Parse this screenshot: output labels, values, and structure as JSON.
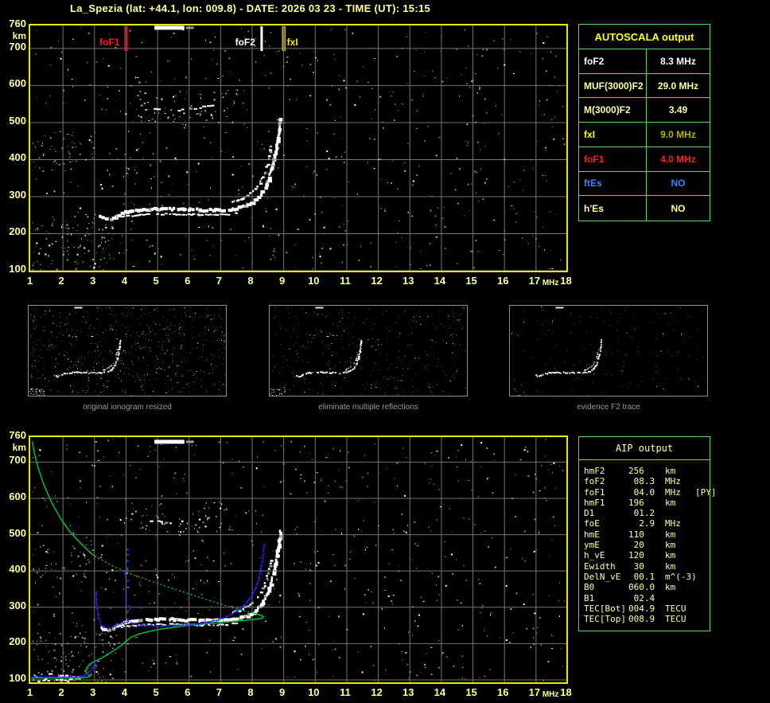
{
  "header": {
    "title": "La_Spezia (lat: +44.1, lon: 009.8) - DATE: 2026 03 23 - TIME (UT): 15:15"
  },
  "autoscala": {
    "title": "AUTOSCALA output",
    "rows": [
      {
        "label": "foF2",
        "value": "8.3 MHz",
        "label_color": "#ffffff",
        "value_color": "#ffffff"
      },
      {
        "label": "MUF(3000)F2",
        "value": "29.0 MHz",
        "label_color": "#ffff9c",
        "value_color": "#ffff9c"
      },
      {
        "label": "M(3000)F2",
        "value": "3.49",
        "label_color": "#ffff9c",
        "value_color": "#ffff9c"
      },
      {
        "label": "fxI",
        "value": "9.0 MHz",
        "label_color": "#ffff00",
        "value_color": "#b4b400"
      },
      {
        "label": "foF1",
        "value": "4.0 MHz",
        "label_color": "#ff1e1e",
        "value_color": "#ff1e1e"
      },
      {
        "label": "ftEs",
        "value": "NO",
        "label_color": "#3b82ff",
        "value_color": "#3b82ff"
      },
      {
        "label": "h'Es",
        "value": "NO",
        "label_color": "#ffff9c",
        "value_color": "#ffff9c"
      }
    ]
  },
  "aip": {
    "title": "AIP output",
    "rows": [
      {
        "label": "hmF2",
        "value": "256",
        "unit": "km",
        "extra": ""
      },
      {
        "label": "foF2",
        "value": " 08.3",
        "unit": "MHz",
        "extra": ""
      },
      {
        "label": "foF1",
        "value": " 04.0",
        "unit": "MHz",
        "extra": "[PY]"
      },
      {
        "label": "hmF1",
        "value": "196",
        "unit": "km",
        "extra": ""
      },
      {
        "label": "D1",
        "value": " 01.2",
        "unit": "",
        "extra": ""
      },
      {
        "label": "foE",
        "value": "  2.9",
        "unit": "MHz",
        "extra": ""
      },
      {
        "label": "hmE",
        "value": "110",
        "unit": "km",
        "extra": ""
      },
      {
        "label": "ymE",
        "value": " 20",
        "unit": "km",
        "extra": ""
      },
      {
        "label": "h_vE",
        "value": "120",
        "unit": "km",
        "extra": ""
      },
      {
        "label": "Ewidth",
        "value": " 30",
        "unit": "km",
        "extra": ""
      },
      {
        "label": "DelN_vE",
        "value": " 00.1",
        "unit": "m^(-3)",
        "extra": ""
      },
      {
        "label": "B0",
        "value": "060.0",
        "unit": "km",
        "extra": ""
      },
      {
        "label": "B1",
        "value": " 02.4",
        "unit": "",
        "extra": ""
      },
      {
        "label": "TEC[Bot]",
        "value": "004.9",
        "unit": "TECU",
        "extra": ""
      },
      {
        "label": "TEC[Top]",
        "value": "008.9",
        "unit": "TECU",
        "extra": ""
      }
    ]
  },
  "thumbnails": [
    {
      "caption": "original ionogram resized"
    },
    {
      "caption": "eliminate multiple reflections"
    },
    {
      "caption": "evidence F2 trace"
    }
  ],
  "colors": {
    "axis_label": "#ffff9c",
    "plot_border": "#e8e800",
    "grid": "#757575",
    "table_border": "#5fd35f",
    "profile_green": "#00c83c",
    "restored_blue": "#2626ff",
    "echo_white": "#ffffff"
  },
  "chart_data": [
    {
      "type": "scatter",
      "panel": "top-ionogram",
      "xlabel": "MHz",
      "ylabel": "km",
      "xlim": [
        1,
        18
      ],
      "ylim": [
        100,
        760
      ],
      "grid": true,
      "x_ticks": [
        "1",
        "2",
        "3",
        "4",
        "5",
        "6",
        "7",
        "8",
        "9",
        "10",
        "11",
        "12",
        "13",
        "14",
        "15",
        "16",
        "17",
        "18"
      ],
      "y_ticks": [
        "760",
        "700",
        "600",
        "500",
        "400",
        "300",
        "200",
        "100"
      ],
      "markers": [
        {
          "label": "foF1",
          "f": 4.0,
          "color": "#ff1e1e",
          "style": "double",
          "side": "left"
        },
        {
          "label": "foF2",
          "f": 8.3,
          "color": "#ffffff",
          "style": "single",
          "side": "left"
        },
        {
          "label": "fxI",
          "f": 9.0,
          "color": "#ffe400",
          "style": "double",
          "side": "right"
        }
      ],
      "series": [
        {
          "name": "F-trace O-mode (virtual height, km vs MHz)",
          "points": [
            [
              3.15,
              247
            ],
            [
              3.25,
              240
            ],
            [
              3.4,
              237
            ],
            [
              3.55,
              241
            ],
            [
              3.75,
              251
            ],
            [
              3.95,
              258
            ],
            [
              4.2,
              262
            ],
            [
              4.6,
              265
            ],
            [
              5.0,
              266
            ],
            [
              5.4,
              266
            ],
            [
              5.8,
              265
            ],
            [
              6.2,
              264
            ],
            [
              6.6,
              263
            ],
            [
              7.0,
              263
            ],
            [
              7.3,
              265
            ],
            [
              7.55,
              269
            ],
            [
              7.8,
              275
            ],
            [
              8.0,
              284
            ],
            [
              8.17,
              297
            ],
            [
              8.32,
              315
            ],
            [
              8.45,
              339
            ],
            [
              8.56,
              367
            ],
            [
              8.65,
              397
            ],
            [
              8.72,
              428
            ],
            [
              8.78,
              459
            ],
            [
              8.83,
              489
            ],
            [
              8.86,
              508
            ]
          ]
        },
        {
          "name": "F-trace inner edge",
          "points": [
            [
              3.85,
              246
            ],
            [
              4.3,
              250
            ],
            [
              4.8,
              252
            ],
            [
              5.3,
              253
            ],
            [
              5.8,
              252
            ],
            [
              6.3,
              251
            ],
            [
              6.8,
              251
            ],
            [
              7.2,
              252
            ],
            [
              7.5,
              257
            ]
          ]
        },
        {
          "name": "X-mode rise",
          "points": [
            [
              7.35,
              285
            ],
            [
              7.6,
              293
            ],
            [
              7.85,
              304
            ],
            [
              8.05,
              318
            ],
            [
              8.22,
              336
            ],
            [
              8.35,
              360
            ],
            [
              8.45,
              388
            ],
            [
              8.52,
              414
            ],
            [
              8.56,
              434
            ]
          ]
        },
        {
          "name": "second-hop echo",
          "points": [
            [
              4.45,
              545
            ],
            [
              4.75,
              538
            ],
            [
              5.1,
              534
            ],
            [
              5.5,
              533
            ],
            [
              5.9,
              536
            ],
            [
              6.3,
              540
            ],
            [
              6.7,
              546
            ]
          ]
        },
        {
          "name": "spread echo at top",
          "points": [
            [
              4.9,
              757
            ],
            [
              5.85,
              757
            ],
            [
              6.15,
              757
            ]
          ]
        }
      ]
    },
    {
      "type": "scatter",
      "panel": "bottom-ionogram",
      "xlabel": "MHz",
      "ylabel": "km",
      "xlim": [
        1,
        18
      ],
      "ylim": [
        100,
        760
      ],
      "grid": true,
      "x_ticks": [
        "1",
        "2",
        "3",
        "4",
        "5",
        "6",
        "7",
        "8",
        "9",
        "10",
        "11",
        "12",
        "13",
        "14",
        "15",
        "16",
        "17",
        "18"
      ],
      "y_ticks": [
        "760",
        "700",
        "600",
        "500",
        "400",
        "300",
        "200",
        "100"
      ],
      "echo_traces_ref": "same white echo series as top-ionogram",
      "series": [
        {
          "name": "electron density profile topside (green solid)",
          "points": [
            [
              1.02,
              757
            ],
            [
              1.1,
              722
            ],
            [
              1.22,
              682
            ],
            [
              1.4,
              636
            ],
            [
              1.62,
              592
            ],
            [
              1.9,
              548
            ],
            [
              2.2,
              510
            ],
            [
              2.55,
              477
            ],
            [
              2.85,
              452
            ],
            [
              3.0,
              441
            ]
          ]
        },
        {
          "name": "electron density profile topside (green dotted)",
          "points": [
            [
              3.0,
              441
            ],
            [
              3.6,
              413
            ],
            [
              4.2,
              390
            ],
            [
              4.8,
              372
            ],
            [
              5.4,
              354
            ],
            [
              6.0,
              337
            ],
            [
              6.6,
              320
            ],
            [
              7.2,
              303
            ],
            [
              7.7,
              291
            ],
            [
              8.0,
              285
            ]
          ]
        },
        {
          "name": "electron density profile bottomside (green solid)",
          "points": [
            [
              8.0,
              285
            ],
            [
              8.25,
              279
            ],
            [
              8.36,
              274
            ],
            [
              8.28,
              269
            ],
            [
              8.0,
              266
            ],
            [
              7.6,
              263
            ],
            [
              7.1,
              259
            ],
            [
              6.6,
              255
            ],
            [
              6.1,
              251
            ],
            [
              5.6,
              246
            ],
            [
              5.1,
              240
            ],
            [
              4.7,
              233
            ],
            [
              4.4,
              226
            ],
            [
              4.15,
              217
            ],
            [
              4.02,
              208
            ],
            [
              3.9,
              198
            ],
            [
              3.7,
              186
            ],
            [
              3.45,
              172
            ],
            [
              3.2,
              159
            ],
            [
              3.0,
              151
            ],
            [
              2.85,
              144
            ],
            [
              2.75,
              133
            ],
            [
              2.72,
              122
            ],
            [
              2.79,
              115
            ],
            [
              2.87,
              111
            ],
            [
              2.76,
              107
            ],
            [
              2.5,
              105
            ],
            [
              2.0,
              105
            ],
            [
              1.5,
              105
            ],
            [
              1.0,
              105
            ]
          ]
        },
        {
          "name": "restored trace (blue dots)",
          "points": [
            [
              3.02,
              345
            ],
            [
              3.05,
              310
            ],
            [
              3.08,
              285
            ],
            [
              3.12,
              268
            ],
            [
              3.18,
              255
            ],
            [
              3.28,
              247
            ],
            [
              3.4,
              244
            ],
            [
              3.55,
              248
            ],
            [
              3.75,
              254
            ],
            [
              3.95,
              261
            ],
            [
              4.05,
              262
            ],
            [
              4.2,
              258
            ],
            [
              4.45,
              253
            ],
            [
              4.8,
              251
            ],
            [
              5.2,
              251
            ],
            [
              5.6,
              252
            ],
            [
              6.0,
              254
            ],
            [
              6.3,
              257
            ],
            [
              6.6,
              262
            ],
            [
              6.9,
              268
            ],
            [
              7.2,
              278
            ],
            [
              7.5,
              292
            ],
            [
              7.75,
              310
            ],
            [
              7.95,
              332
            ],
            [
              8.1,
              358
            ],
            [
              8.2,
              388
            ],
            [
              8.28,
              420
            ],
            [
              8.33,
              450
            ],
            [
              8.36,
              475
            ]
          ]
        },
        {
          "name": "blue F1 cusp spike",
          "points": [
            [
              4.02,
              270
            ],
            [
              3.99,
              288
            ],
            [
              4.03,
              305
            ],
            [
              4.0,
              322
            ],
            [
              3.98,
              340
            ],
            [
              4.02,
              358
            ],
            [
              4.0,
              376
            ],
            [
              3.97,
              395
            ],
            [
              4.01,
              412
            ],
            [
              3.99,
              430
            ],
            [
              4.02,
              448
            ],
            [
              4.0,
              462
            ]
          ]
        },
        {
          "name": "blue E-region trace",
          "points": [
            [
              1.0,
              110
            ],
            [
              2.55,
              110
            ],
            [
              2.6,
              112
            ],
            [
              2.7,
              117
            ],
            [
              2.8,
              124
            ],
            [
              2.9,
              133
            ],
            [
              2.97,
              143
            ],
            [
              3.0,
              152
            ]
          ]
        },
        {
          "name": "E-region white echo band",
          "points": [
            [
              1.0,
              101
            ],
            [
              2.45,
              106
            ]
          ]
        }
      ]
    }
  ]
}
